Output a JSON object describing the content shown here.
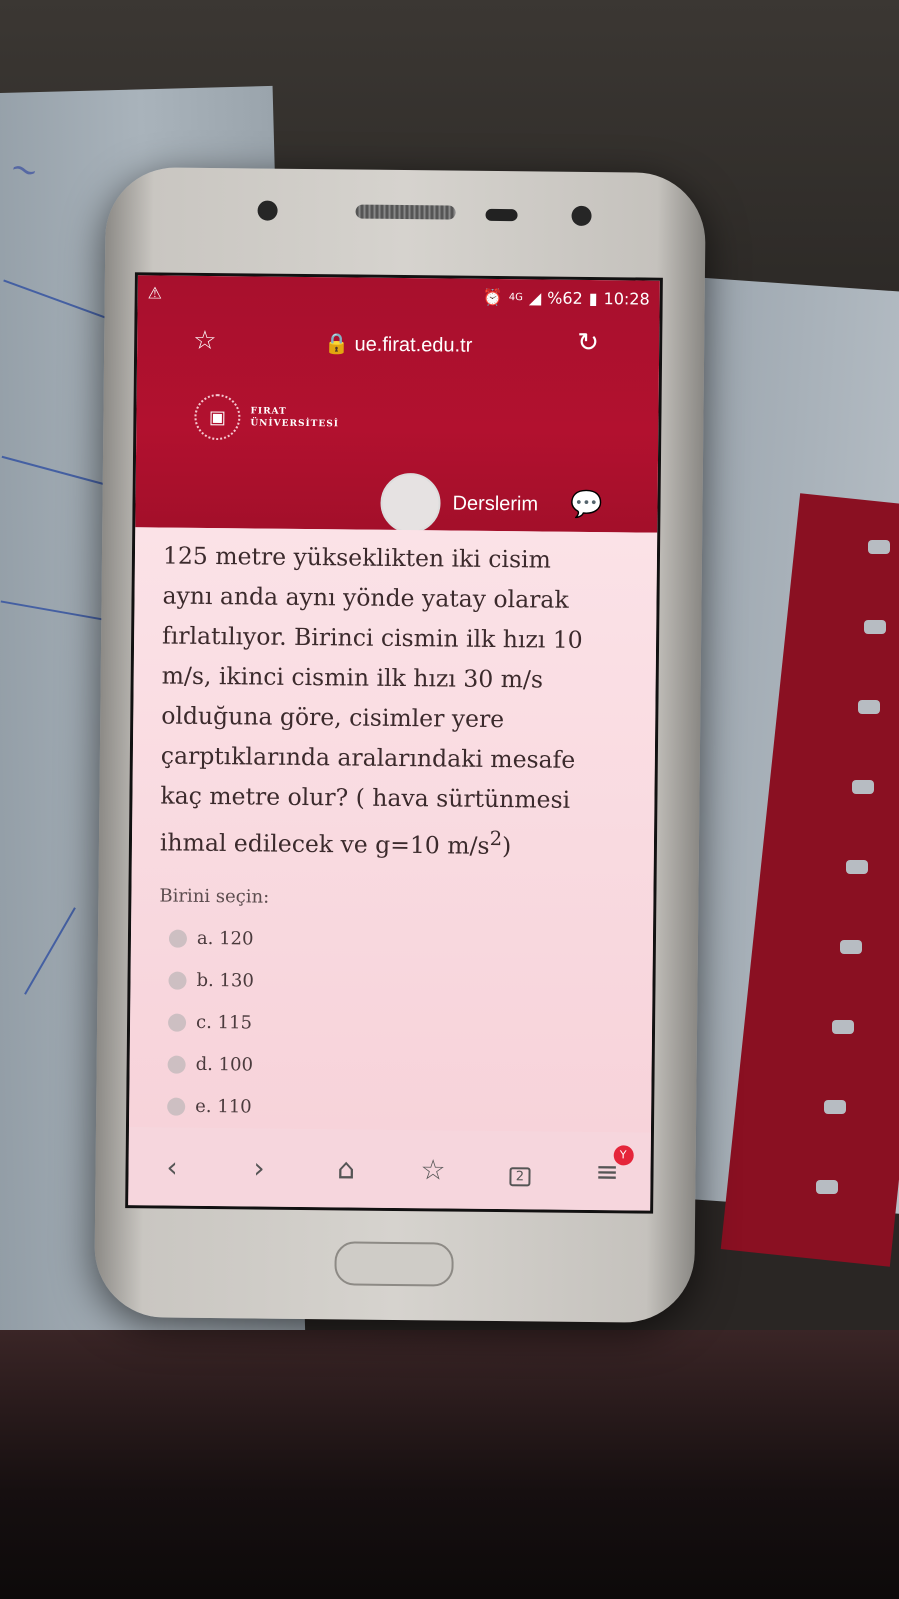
{
  "status_bar": {
    "indicators": "⚠",
    "network": "4G",
    "battery": "%62",
    "time": "10:28"
  },
  "browser": {
    "url": "ue.firat.edu.tr"
  },
  "site_header": {
    "logo_line1": "FIRAT",
    "logo_line2": "ÜNİVERSİTESİ",
    "nav_link": "Derslerim"
  },
  "question": {
    "text_line1": "125 metre yükseklikten iki cisim",
    "text_line2": "aynı anda aynı yönde yatay olarak",
    "text_line3": "fırlatılıyor. Birinci cismin ilk hızı 10",
    "text_line4": "m/s, ikinci cismin ilk hızı 30 m/s",
    "text_line5": "olduğuna göre, cisimler yere",
    "text_line6": "çarptıklarında aralarındaki mesafe",
    "text_line7": "kaç metre olur? ( hava sürtünmesi",
    "text_line8_main": "ihmal edilecek ve g=10 m/s",
    "text_line8_sup": "2",
    "text_line8_end": ")",
    "prompt": "Birini seçin:"
  },
  "options": [
    {
      "label": "a. 120"
    },
    {
      "label": "b. 130"
    },
    {
      "label": "c. 115"
    },
    {
      "label": "d. 100"
    },
    {
      "label": "e. 110"
    }
  ],
  "bottom_nav": {
    "tab_count": "2",
    "badge": "Y"
  },
  "colors": {
    "header_red": "#a8102d",
    "page_pink": "#fbe2e7",
    "badge_red": "#e5253a"
  }
}
